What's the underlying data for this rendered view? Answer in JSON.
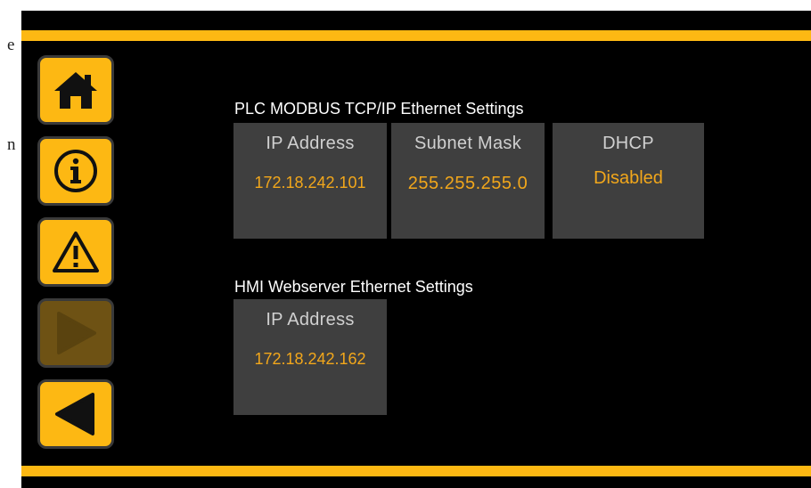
{
  "page_edge": {
    "fragments": [
      "e",
      "n"
    ]
  },
  "theme": {
    "accent": "#FDB813",
    "accent_disabled": "#6e5214",
    "tile_bg": "#3f3f3f",
    "label_color": "#d0d0d0",
    "value_color": "#F2A71B"
  },
  "nav": [
    {
      "icon": "home-icon",
      "enabled": true
    },
    {
      "icon": "info-icon",
      "enabled": true
    },
    {
      "icon": "warning-icon",
      "enabled": true
    },
    {
      "icon": "play-forward-icon",
      "enabled": false
    },
    {
      "icon": "back-icon",
      "enabled": true
    }
  ],
  "plc": {
    "title": "PLC MODBUS TCP/IP Ethernet Settings",
    "ip_label": "IP Address",
    "ip_value": "172.18.242.101",
    "subnet_label": "Subnet Mask",
    "subnet_value": "255.255.255.0",
    "dhcp_label": "DHCP",
    "dhcp_value": "Disabled"
  },
  "hmi": {
    "title": "HMI Webserver Ethernet Settings",
    "ip_label": "IP Address",
    "ip_value": "172.18.242.162"
  }
}
